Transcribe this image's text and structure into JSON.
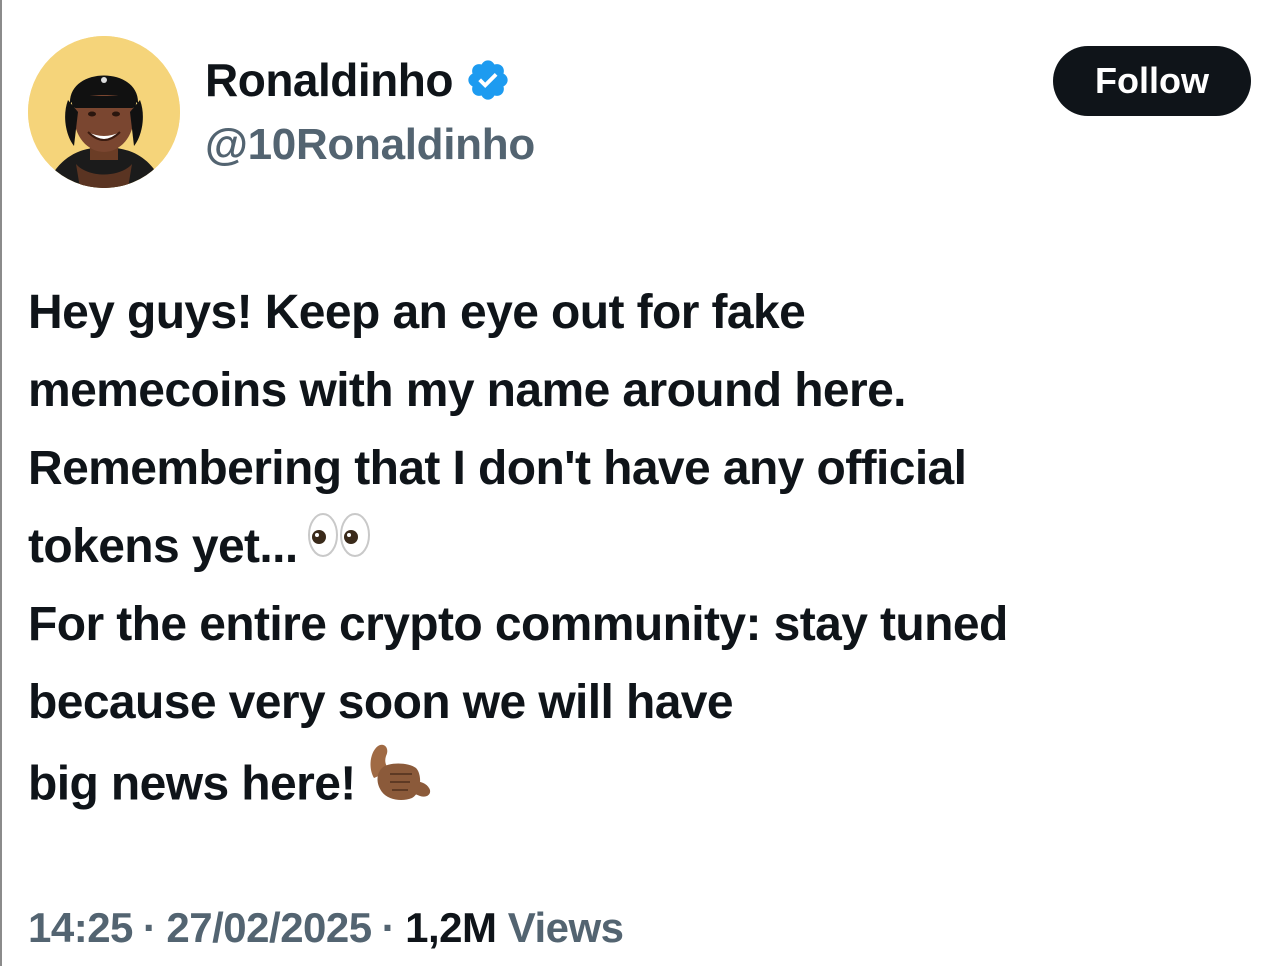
{
  "author": {
    "display_name": "Ronaldinho",
    "handle": "@10Ronaldinho",
    "verified_icon": "verified-badge-icon",
    "avatar": "avatar-image"
  },
  "follow_button": {
    "label": "Follow"
  },
  "tweet": {
    "lines": [
      "Hey guys! Keep an eye out for fake",
      "memecoins with my name around here.",
      "Remembering that I don't have any official",
      "tokens yet...",
      "For the entire crypto community: stay tuned",
      "because very soon we will have",
      "big news here!"
    ],
    "emojis": [
      "eyes-emoji",
      "call-me-hand-emoji"
    ]
  },
  "meta": {
    "time": "14:25",
    "separator": "·",
    "date": "27/02/2025",
    "views_count": "1,2M",
    "views_label": "Views"
  },
  "colors": {
    "text_primary": "#0f1419",
    "text_secondary": "#536471",
    "verified_blue": "#1d9bf0",
    "avatar_bg": "#f5d47a"
  }
}
